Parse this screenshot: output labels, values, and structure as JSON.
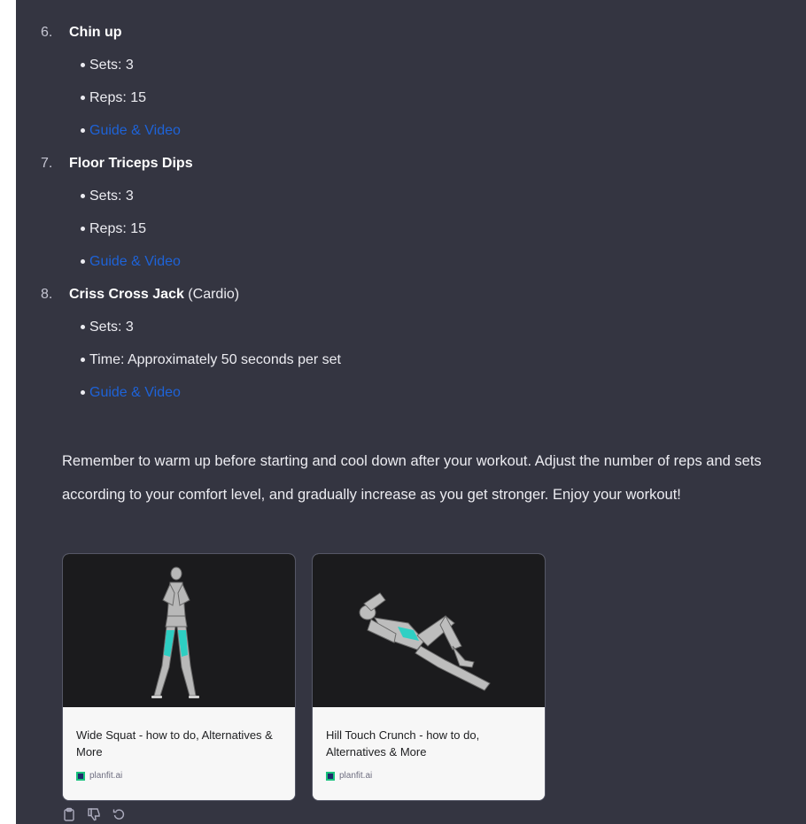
{
  "items": [
    {
      "number": "6.",
      "name": "Chin up",
      "extra": "",
      "bullets": [
        {
          "text": "Sets: 3",
          "link": false
        },
        {
          "text": "Reps: 15",
          "link": false
        },
        {
          "text": "Guide & Video",
          "link": true
        }
      ]
    },
    {
      "number": "7.",
      "name": "Floor Triceps Dips",
      "extra": "",
      "bullets": [
        {
          "text": "Sets: 3",
          "link": false
        },
        {
          "text": "Reps: 15",
          "link": false
        },
        {
          "text": "Guide & Video",
          "link": true
        }
      ]
    },
    {
      "number": "8.",
      "name": "Criss Cross Jack",
      "extra": " (Cardio)",
      "bullets": [
        {
          "text": "Sets: 3",
          "link": false
        },
        {
          "text": "Time: Approximately 50 seconds per set",
          "link": false
        },
        {
          "text": "Guide & Video",
          "link": true
        }
      ]
    }
  ],
  "closing": "Remember to warm up before starting and cool down after your workout. Adjust the number of reps and sets according to your comfort level, and gradually increase as you get stronger. Enjoy your workout!",
  "cards": [
    {
      "title": "Wide Squat - how to do, Alternatives & More",
      "source": "planfit.ai",
      "image_icon": "standing-figure-illustration"
    },
    {
      "title": "Hill Touch Crunch - how to do, Alternatives & More",
      "source": "planfit.ai",
      "image_icon": "crunch-figure-illustration"
    }
  ],
  "actions": [
    {
      "icon": "clipboard-icon"
    },
    {
      "icon": "thumbs-down-icon"
    },
    {
      "icon": "regenerate-icon"
    }
  ],
  "colors": {
    "background": "#343541",
    "link": "#1e63d8",
    "accent_muscle": "#1fd1c4"
  }
}
